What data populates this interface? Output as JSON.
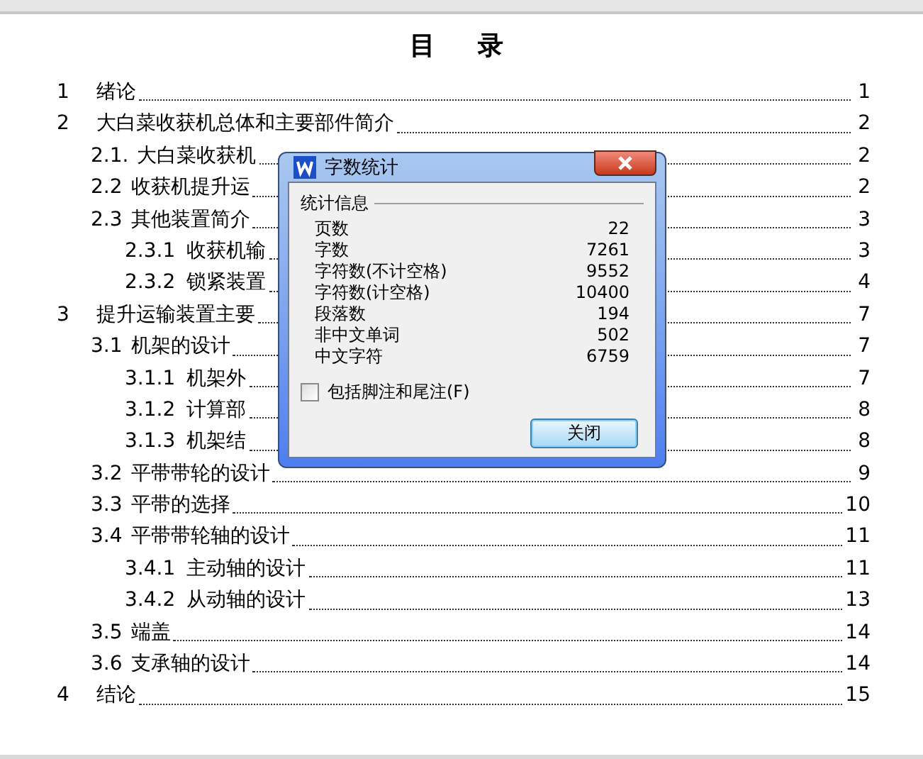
{
  "document": {
    "title": "目　录",
    "toc": [
      {
        "number": "1",
        "title": "绪论",
        "page": "1"
      },
      {
        "number": "2",
        "title": "大白菜收获机总体和主要部件简介",
        "page": "2",
        "children": [
          {
            "number": "2.1.",
            "title": "大白菜收获机",
            "page": "2"
          },
          {
            "number": "2.2",
            "title": "收获机提升运",
            "page": "2"
          },
          {
            "number": "2.3",
            "title": "其他装置简介",
            "page": "3",
            "children": [
              {
                "number": "2.3.1",
                "title": "收获机输",
                "page": "3"
              },
              {
                "number": "2.3.2",
                "title": "锁紧装置",
                "page": "4"
              }
            ]
          }
        ]
      },
      {
        "number": "3",
        "title": "提升运输装置主要",
        "page": "7",
        "children": [
          {
            "number": "3.1",
            "title": "机架的设计",
            "page": "7",
            "children": [
              {
                "number": "3.1.1",
                "title": "机架外",
                "page": "7"
              },
              {
                "number": "3.1.2",
                "title": "计算部",
                "page": "8"
              },
              {
                "number": "3.1.3",
                "title": "机架结",
                "page": "8"
              }
            ]
          },
          {
            "number": "3.2",
            "title": "平带带轮的设计",
            "page": "9"
          },
          {
            "number": "3.3",
            "title": "平带的选择",
            "page": "10"
          },
          {
            "number": "3.4",
            "title": "平带带轮轴的设计",
            "page": "11",
            "children": [
              {
                "number": "3.4.1",
                "title": "主动轴的设计",
                "page": "11"
              },
              {
                "number": "3.4.2",
                "title": "从动轴的设计",
                "page": "13"
              }
            ]
          },
          {
            "number": "3.5",
            "title": "端盖",
            "page": "14"
          },
          {
            "number": "3.6",
            "title": "支承轴的设计",
            "page": "14"
          }
        ]
      },
      {
        "number": "4",
        "title": "结论",
        "page": "15"
      }
    ]
  },
  "dialog": {
    "title": "字数统计",
    "group": "统计信息",
    "stats": [
      {
        "label": "页数",
        "value": "22"
      },
      {
        "label": "字数",
        "value": "7261"
      },
      {
        "label": "字符数(不计空格)",
        "value": "9552"
      },
      {
        "label": "字符数(计空格)",
        "value": "10400"
      },
      {
        "label": "段落数",
        "value": "194"
      },
      {
        "label": "非中文单词",
        "value": "502"
      },
      {
        "label": "中文字符",
        "value": "6759"
      }
    ],
    "checkbox": {
      "label": "包括脚注和尾注(F)",
      "checked": false
    },
    "button": "关闭"
  }
}
